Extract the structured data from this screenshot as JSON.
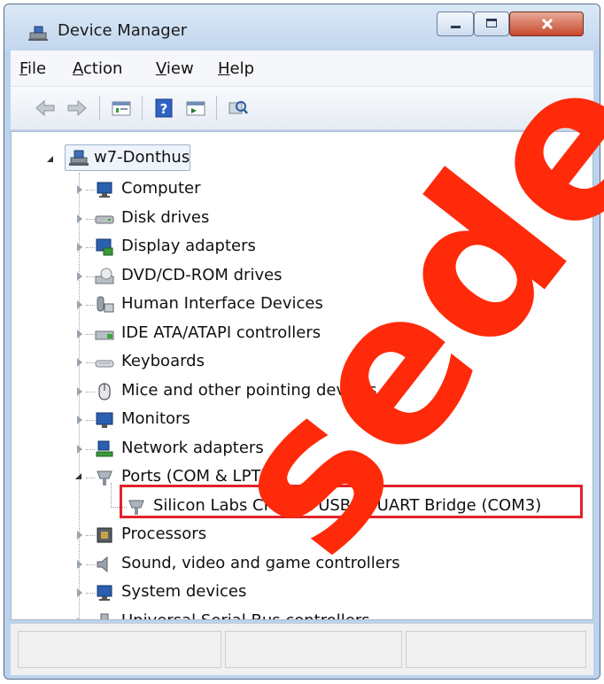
{
  "window": {
    "title": "Device Manager",
    "controls": {
      "minimize": "minimize",
      "maximize": "maximize",
      "close": "close"
    }
  },
  "menu": [
    {
      "label": "File",
      "mnemonic": "F",
      "rest": "ile"
    },
    {
      "label": "Action",
      "mnemonic": "A",
      "rest": "ction"
    },
    {
      "label": "View",
      "mnemonic": "V",
      "rest": "iew"
    },
    {
      "label": "Help",
      "mnemonic": "H",
      "rest": "elp"
    }
  ],
  "toolbar": {
    "icons": [
      "back-icon",
      "forward-icon",
      "properties-icon",
      "help-icon",
      "update-driver-icon",
      "scan-hardware-icon"
    ]
  },
  "tree": {
    "root": {
      "label": "w7-Donthus",
      "icon": "computer-network-icon",
      "expanded": true
    },
    "items": [
      {
        "label": "Computer",
        "icon": "computer-icon",
        "expanded": false
      },
      {
        "label": "Disk drives",
        "icon": "disk-drive-icon",
        "expanded": false
      },
      {
        "label": "Display adapters",
        "icon": "display-adapter-icon",
        "expanded": false
      },
      {
        "label": "DVD/CD-ROM drives",
        "icon": "dvd-drive-icon",
        "expanded": false
      },
      {
        "label": "Human Interface Devices",
        "icon": "hid-icon",
        "expanded": false
      },
      {
        "label": "IDE ATA/ATAPI controllers",
        "icon": "ide-controller-icon",
        "expanded": false
      },
      {
        "label": "Keyboards",
        "icon": "keyboard-icon",
        "expanded": false
      },
      {
        "label": "Mice and other pointing devices",
        "icon": "mouse-icon",
        "expanded": false
      },
      {
        "label": "Monitors",
        "icon": "monitor-icon",
        "expanded": false
      },
      {
        "label": "Network adapters",
        "icon": "network-adapter-icon",
        "expanded": false
      },
      {
        "label": "Ports (COM & LPT)",
        "icon": "port-icon",
        "expanded": true,
        "children": [
          {
            "label": "Silicon Labs CP210x USB to UART Bridge (COM3)",
            "icon": "port-icon",
            "highlighted": true
          }
        ]
      },
      {
        "label": "Processors",
        "icon": "processor-icon",
        "expanded": false
      },
      {
        "label": "Sound, video and game controllers",
        "icon": "sound-icon",
        "expanded": false
      },
      {
        "label": "System devices",
        "icon": "system-device-icon",
        "expanded": false
      },
      {
        "label": "Universal Serial Bus controllers",
        "icon": "usb-icon",
        "expanded": false
      }
    ]
  },
  "watermark": {
    "text": "sede",
    "color": "#ff2a0a"
  },
  "colors": {
    "highlight_border": "#e2222a",
    "close_button": "#c7492d"
  }
}
